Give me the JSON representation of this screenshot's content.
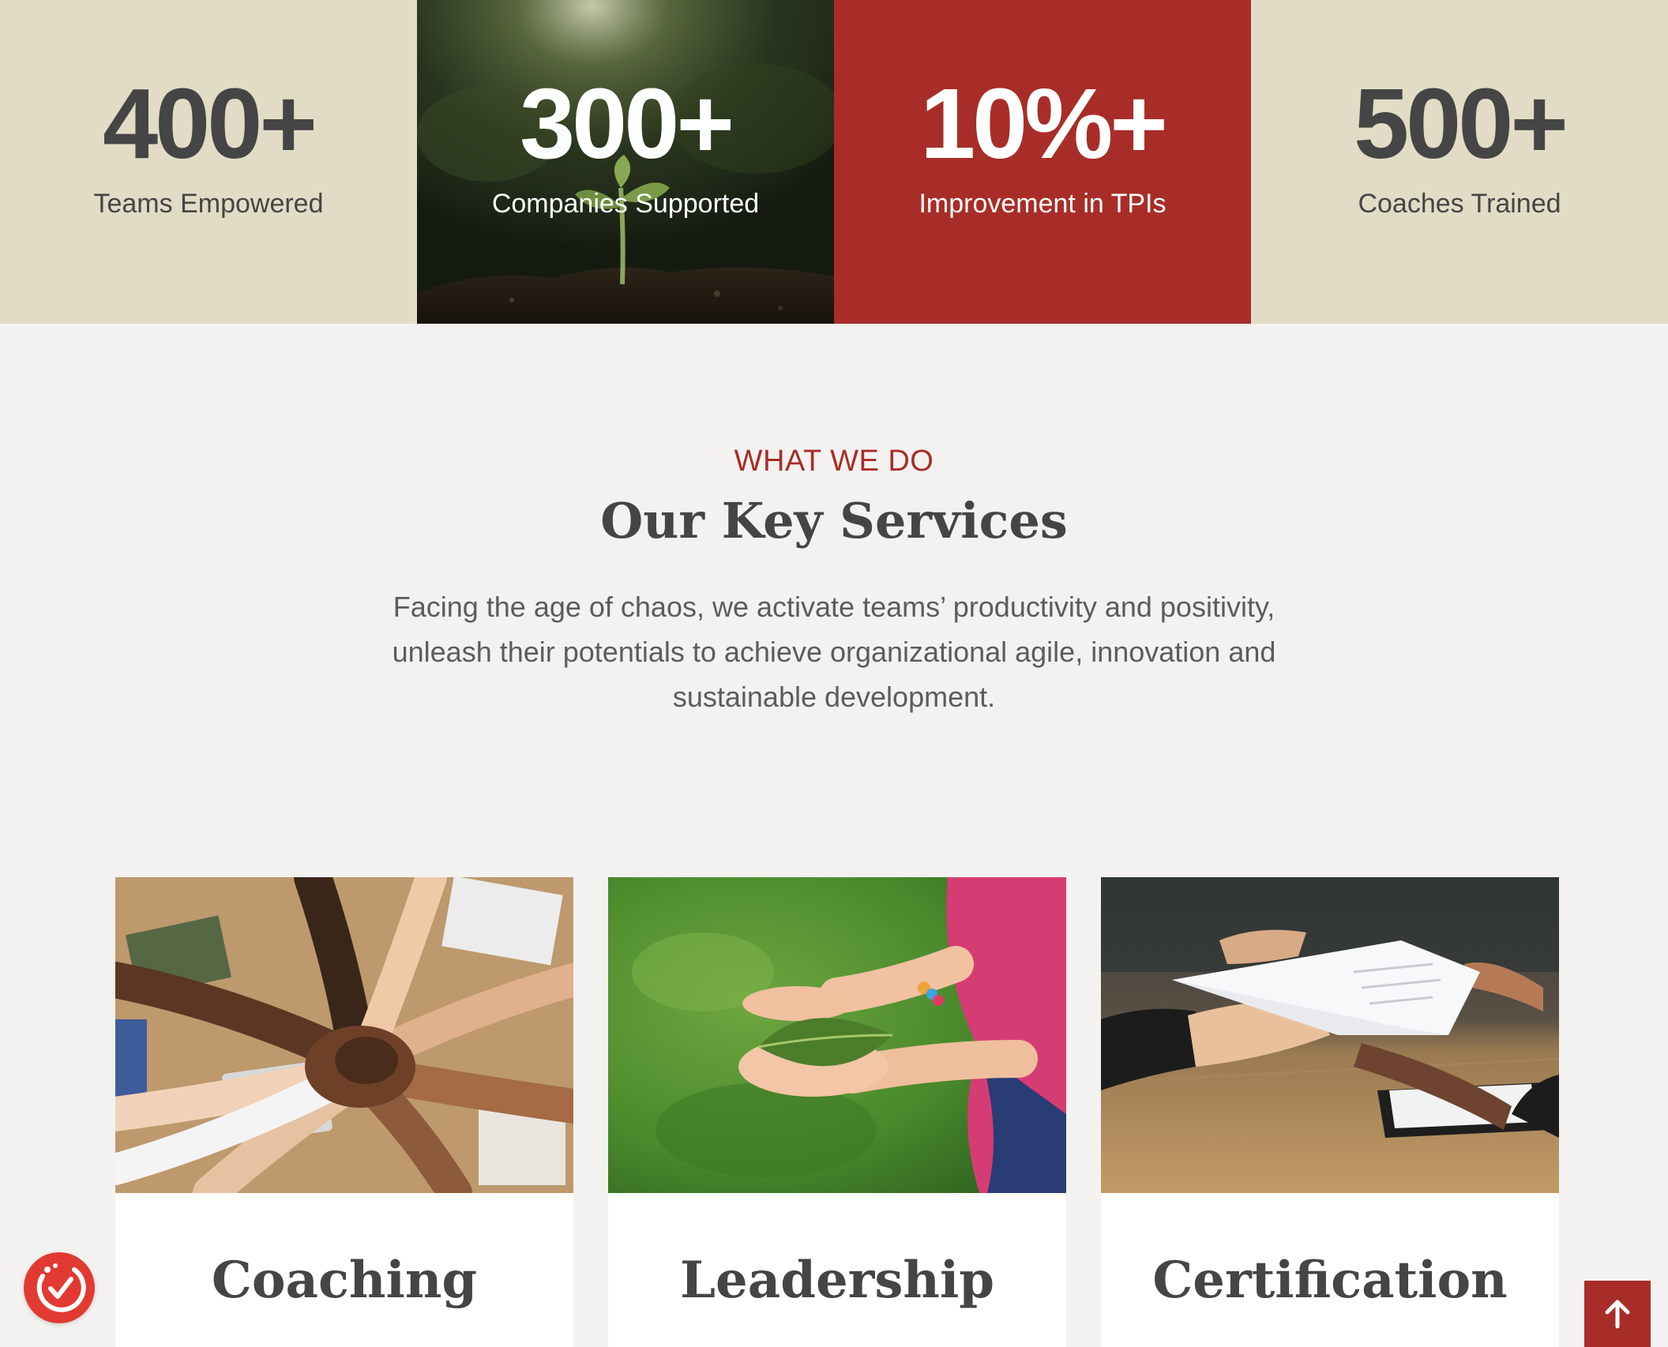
{
  "stats": [
    {
      "number": "400+",
      "label": "Teams Empowered"
    },
    {
      "number": "300+",
      "label": "Companies Supported"
    },
    {
      "number": "10%+",
      "label": "Improvement in TPIs"
    },
    {
      "number": "500+",
      "label": "Coaches Trained"
    }
  ],
  "section": {
    "eyebrow": "WHAT WE DO",
    "heading": "Our Key Services",
    "description": "Facing the age of chaos, we activate teams’ productivity and positivity, unleash their potentials to achieve organizational agile, innovation and sustainable development."
  },
  "services": [
    {
      "title": "Coaching",
      "image": "hands-stacked-teamwork"
    },
    {
      "title": "Leadership",
      "image": "hands-holding-leaf"
    },
    {
      "title": "Certification",
      "image": "handing-over-document"
    }
  ],
  "widgets": {
    "accessibility_icon": "accessibility-check-icon",
    "back_to_top_icon": "arrow-up-icon"
  },
  "colors": {
    "accent_red": "#a82d28",
    "beige": "#e2dcc6",
    "page_background": "#f3f2f0",
    "text_dark": "#454545",
    "widget_red": "#e23a33"
  }
}
